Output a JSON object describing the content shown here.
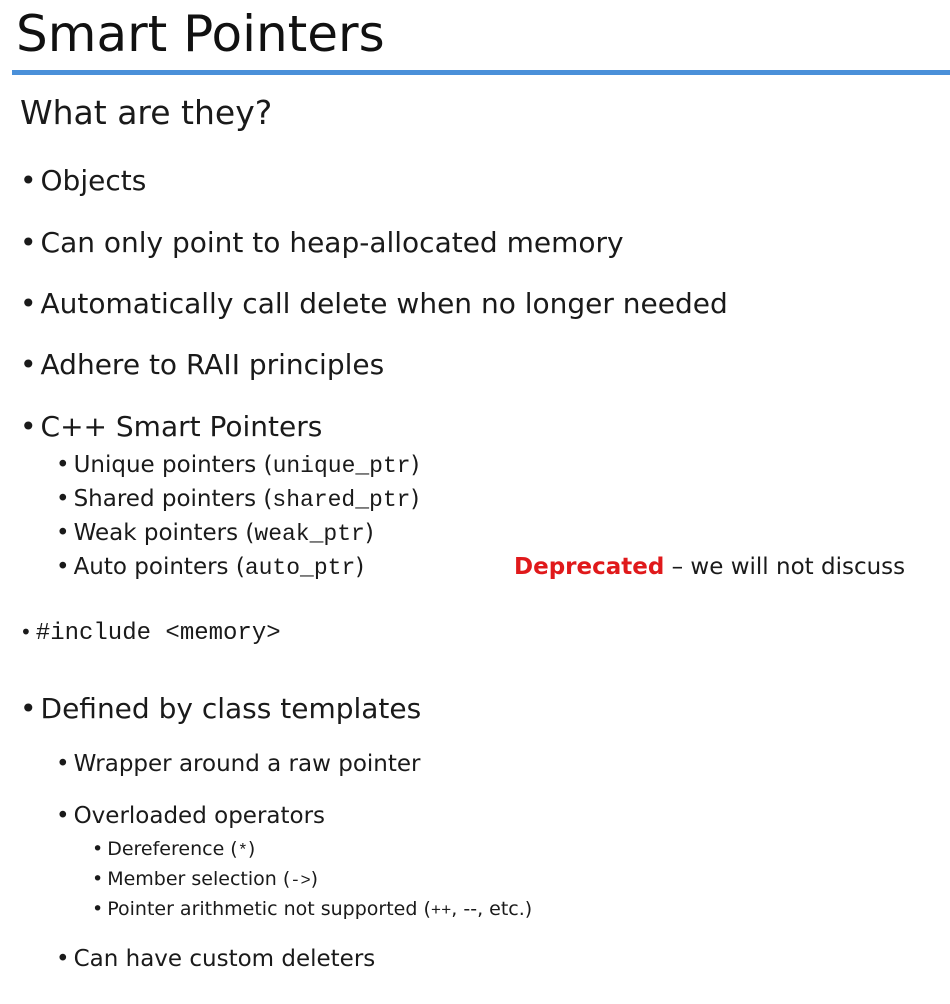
{
  "slide": {
    "title": "Smart Pointers",
    "subtitle": "What are they?",
    "accent_color": "#4a90d9",
    "bullet_symbol": "•",
    "points": [
      "Objects",
      "Can only point to heap-allocated memory",
      "Automatically call delete when no longer needed",
      "Adhere to RAII principles",
      "C++ Smart Pointers"
    ],
    "smart_pointer_types": [
      {
        "label": "Unique pointers (",
        "code": "unique_ptr",
        "close": ")"
      },
      {
        "label": "Shared pointers (",
        "code": "shared_ptr",
        "close": ")"
      },
      {
        "label": "Weak pointers (",
        "code": "weak_ptr",
        "close": ")"
      },
      {
        "label": "Auto pointers (",
        "code": "auto_ptr",
        "close": ")"
      }
    ],
    "deprecation_note": {
      "label": "Deprecated",
      "text": " – we will not discuss",
      "color": "#e0191b"
    },
    "include_line": "#include <memory>",
    "templates_point": "Defined by class templates",
    "template_details": {
      "wrapper": "Wrapper around a raw pointer",
      "operators": "Overloaded operators",
      "operator_items": [
        {
          "label": "Dereference (",
          "code": "*",
          "close": ")"
        },
        {
          "label": "Member selection (",
          "code": "->",
          "close": ")"
        },
        {
          "label": "Pointer arithmetic not supported (",
          "code": "++",
          "close": ", --, etc.)"
        }
      ],
      "deleters": "Can have custom deleters"
    }
  }
}
